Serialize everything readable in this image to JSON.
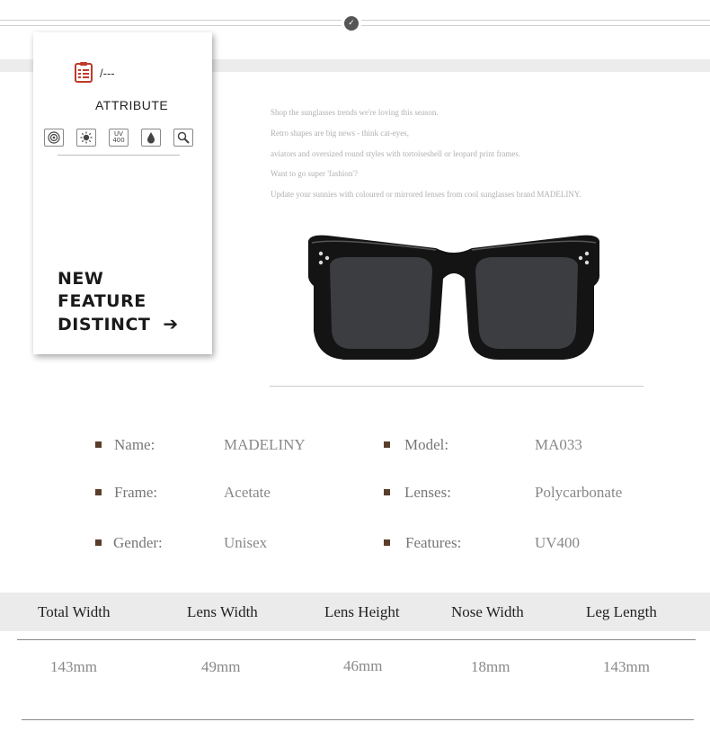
{
  "card": {
    "top_label": "/---",
    "title": "ATTRIBUTE",
    "uv_line1": "UV",
    "uv_line2": "400",
    "feature_line1": "NEW",
    "feature_line2": "FEATURE",
    "feature_line3": "DISTINCT",
    "arrow": "➔"
  },
  "description": [
    "Shop the sunglasses trends we're loving this season.",
    "Retro shapes are big news - think cat-eyes,",
    "aviators and oversized round styles with tortoiseshell or leopard print frames.",
    "Want to go super 'fashion'?",
    "Update your sunnies with coloured or mirrored lenses from cool sunglasses brand MADELINY."
  ],
  "specs": [
    {
      "label": "Name:",
      "value": "MADELINY"
    },
    {
      "label": "Model:",
      "value": "MA033"
    },
    {
      "label": "Frame:",
      "value": "Acetate"
    },
    {
      "label": "Lenses:",
      "value": "Polycarbonate"
    },
    {
      "label": "Gender:",
      "value": "Unisex"
    },
    {
      "label": "Features:",
      "value": "UV400"
    }
  ],
  "sizes": {
    "headers": [
      "Total Width",
      "Lens Width",
      "Lens Height",
      "Nose Width",
      "Leg Length"
    ],
    "values": [
      "143mm",
      "49mm",
      "46mm",
      "18mm",
      "143mm"
    ]
  },
  "colors": {
    "bullet": "#5a3e2b",
    "card_icon": "#c0392b",
    "table_header_bg": "#ebebeb"
  }
}
